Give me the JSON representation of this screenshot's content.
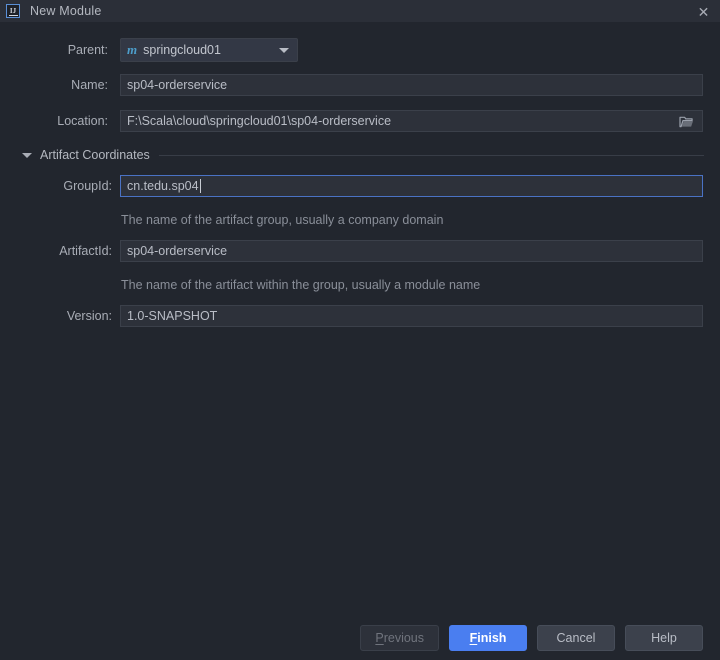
{
  "window": {
    "title": "New Module",
    "app_icon": "intellij-idea-icon",
    "close_label": "✕"
  },
  "form": {
    "parent": {
      "label": "Parent:",
      "value": "springcloud01",
      "icon": "maven-module-icon",
      "dropdown_icon": "chevron-down-icon"
    },
    "name": {
      "label": "Name:",
      "value": "sp04-orderservice"
    },
    "location": {
      "label": "Location:",
      "value": "F:\\Scala\\cloud\\springcloud01\\sp04-orderservice",
      "browse_icon": "folder-icon"
    }
  },
  "section": {
    "title": "Artifact Coordinates",
    "expanded": true,
    "toggle_icon": "triangle-down-icon",
    "fields": {
      "group_id": {
        "label": "GroupId:",
        "value": "cn.tedu.sp04",
        "hint": "The name of the artifact group, usually a company domain",
        "focused": true
      },
      "artifact_id": {
        "label": "ArtifactId:",
        "value": "sp04-orderservice",
        "hint": "The name of the artifact within the group, usually a module name",
        "focused": false
      },
      "version": {
        "label": "Version:",
        "value": "1.0-SNAPSHOT",
        "focused": false
      }
    }
  },
  "buttons": {
    "previous": {
      "label": "Previous",
      "mnemonic": "P",
      "rest": "revious",
      "state": "disabled"
    },
    "finish": {
      "label": "Finish",
      "mnemonic": "F",
      "rest": "inish",
      "state": "default"
    },
    "cancel": {
      "label": "Cancel",
      "state": "normal"
    },
    "help": {
      "label": "Help",
      "state": "normal"
    }
  },
  "colors": {
    "dialog_bg": "#22262e",
    "titlebar_bg": "#2b2f38",
    "field_bg": "#2d313a",
    "focus_border": "#4a72c4",
    "accent_button": "#4a7ef0",
    "maven_icon": "#4d9ecb"
  }
}
